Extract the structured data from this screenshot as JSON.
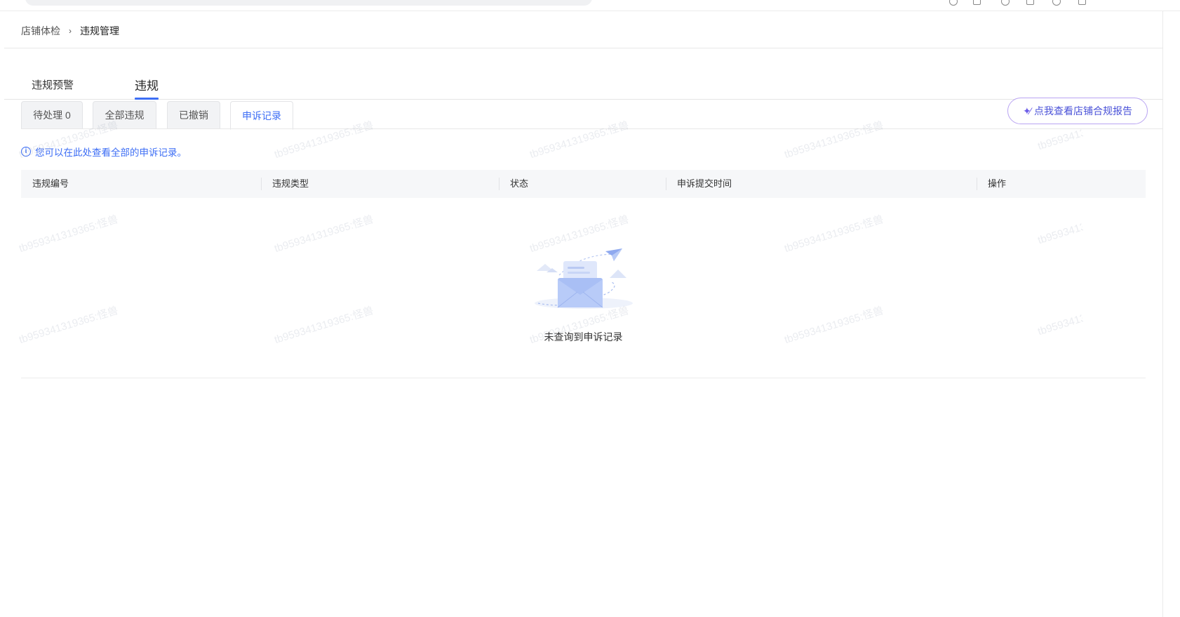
{
  "breadcrumb": {
    "parent": "店铺体检",
    "separator": "›",
    "current": "违规管理"
  },
  "main_tabs": [
    {
      "label": "违规预警",
      "active": false
    },
    {
      "label": "违规",
      "active": true
    }
  ],
  "sub_tabs": [
    {
      "label": "待处理 0",
      "active": false
    },
    {
      "label": "全部违规",
      "active": false
    },
    {
      "label": "已撤销",
      "active": false
    },
    {
      "label": "申诉记录",
      "active": true
    }
  ],
  "report_button": {
    "icon": "sparkle-wand-icon",
    "label": "点我查看店铺合规报告"
  },
  "notice": {
    "icon": "info-icon",
    "text": "您可以在此处查看全部的申诉记录。"
  },
  "table": {
    "columns": [
      "违规编号",
      "违规类型",
      "状态",
      "申诉提交时间",
      "操作"
    ],
    "rows": []
  },
  "empty_state": {
    "illustration": "empty-mail-envelope-icon",
    "text": "未查询到申诉记录"
  },
  "watermark": "tb959341319365:怪兽",
  "colors": {
    "primary": "#3d6ef5",
    "report_border": "#b9a4f2",
    "tab_bg": "#f2f3f5",
    "table_header_bg": "#f6f7f9"
  }
}
